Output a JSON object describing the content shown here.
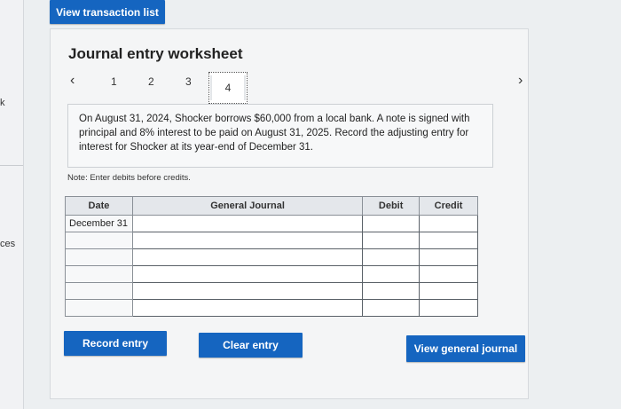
{
  "left_fragments": [
    "k",
    "ces"
  ],
  "top_button": "View transaction list",
  "worksheet": {
    "title": "Journal entry worksheet",
    "tabs": [
      "1",
      "2",
      "3",
      "4"
    ],
    "prev_icon": "chevron-left-icon",
    "next_icon": "chevron-right-icon",
    "prompt": "On August 31, 2024, Shocker borrows $60,000 from a local bank. A note is signed with principal and 8% interest to be paid on August 31, 2025. Record the adjusting entry for interest for Shocker at its year-end of December 31.",
    "note": "Note: Enter debits before credits."
  },
  "table": {
    "headers": {
      "date": "Date",
      "journal": "General Journal",
      "debit": "Debit",
      "credit": "Credit"
    },
    "rows": [
      {
        "date": "December 31",
        "account": "",
        "debit": "",
        "credit": ""
      },
      {
        "date": "",
        "account": "",
        "debit": "",
        "credit": ""
      },
      {
        "date": "",
        "account": "",
        "debit": "",
        "credit": ""
      },
      {
        "date": "",
        "account": "",
        "debit": "",
        "credit": ""
      },
      {
        "date": "",
        "account": "",
        "debit": "",
        "credit": ""
      },
      {
        "date": "",
        "account": "",
        "debit": "",
        "credit": ""
      }
    ]
  },
  "buttons": {
    "record": "Record entry",
    "clear": "Clear entry",
    "view_general": "View general journal"
  },
  "colors": {
    "accent": "#1565c0",
    "background": "#eceff1"
  }
}
